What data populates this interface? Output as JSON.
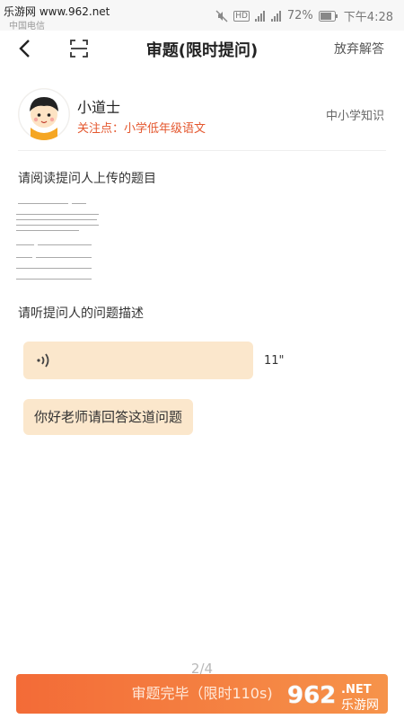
{
  "status_bar": {
    "watermark": "乐游网 www.962.net",
    "carrier": "中国电信",
    "hd_badge": "HD",
    "signal_labels": [
      "4G",
      "2G"
    ],
    "battery": "72%",
    "time": "下午4:28"
  },
  "nav": {
    "back_icon": "chevron-left-icon",
    "scan_icon": "scan-icon",
    "title": "审题(限时提问)",
    "abandon_label": "放弃解答"
  },
  "profile": {
    "avatar_icon": "child-avatar",
    "name": "小道士",
    "focus": "关注点：小学低年级语文",
    "category": "中小学知识"
  },
  "question": {
    "read_label": "请阅读提问人上传的题目",
    "listen_label": "请听提问人的问题描述",
    "voice_icon": "voice-wave-icon",
    "voice_duration": "11\"",
    "text_message": "你好老师请回答这道问题"
  },
  "footer": {
    "pager": "2/4",
    "submit_label": "审题完毕（限时110s)",
    "watermark": "962 乐游网 .NET"
  },
  "colors": {
    "accent": "#f36b37",
    "focus_text": "#e4572e",
    "bubble": "#fbe7cc"
  }
}
